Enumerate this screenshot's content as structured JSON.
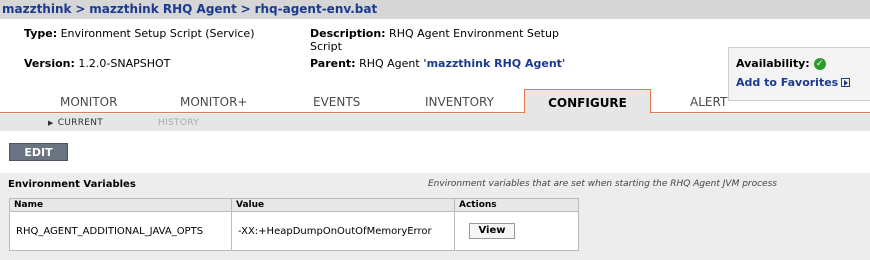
{
  "breadcrumb": {
    "items": [
      "mazzthink",
      "mazzthink RHQ Agent",
      "rhq-agent-env.bat"
    ],
    "separator": ">"
  },
  "summary": {
    "type_label": "Type:",
    "type_value": "Environment Setup Script (Service)",
    "version_label": "Version:",
    "version_value": "1.2.0-SNAPSHOT",
    "description_label": "Description:",
    "description_value": "RHQ Agent Environment Setup Script",
    "parent_label": "Parent:",
    "parent_prefix": "RHQ Agent",
    "parent_link": "'mazzthink RHQ Agent'"
  },
  "availability": {
    "label": "Availability:",
    "status_icon": "check-circle-icon",
    "status_color": "#2f9a2f",
    "favorites_label": "Add to Favorites"
  },
  "tabs": [
    {
      "label": "Monitor",
      "active": false
    },
    {
      "label": "Monitor+",
      "active": false
    },
    {
      "label": "Events",
      "active": false
    },
    {
      "label": "Inventory",
      "active": false
    },
    {
      "label": "Configure",
      "active": true
    },
    {
      "label": "Alert",
      "active": false
    }
  ],
  "subtabs": {
    "current": "Current",
    "history": "History"
  },
  "toolbar": {
    "edit_label": "EDIT"
  },
  "env_section": {
    "title": "Environment Variables",
    "note": "Environment variables that are set when starting the RHQ Agent JVM process",
    "columns": [
      "Name",
      "Value",
      "Actions"
    ],
    "rows": [
      {
        "name": "RHQ_AGENT_ADDITIONAL_JAVA_OPTS",
        "value": "-XX:+HeapDumpOnOutOfMemoryError",
        "action": "View"
      }
    ]
  },
  "colors": {
    "tab_accent": "#e07a50",
    "link": "#1a3a8f",
    "edit_button": "#6a7382"
  }
}
